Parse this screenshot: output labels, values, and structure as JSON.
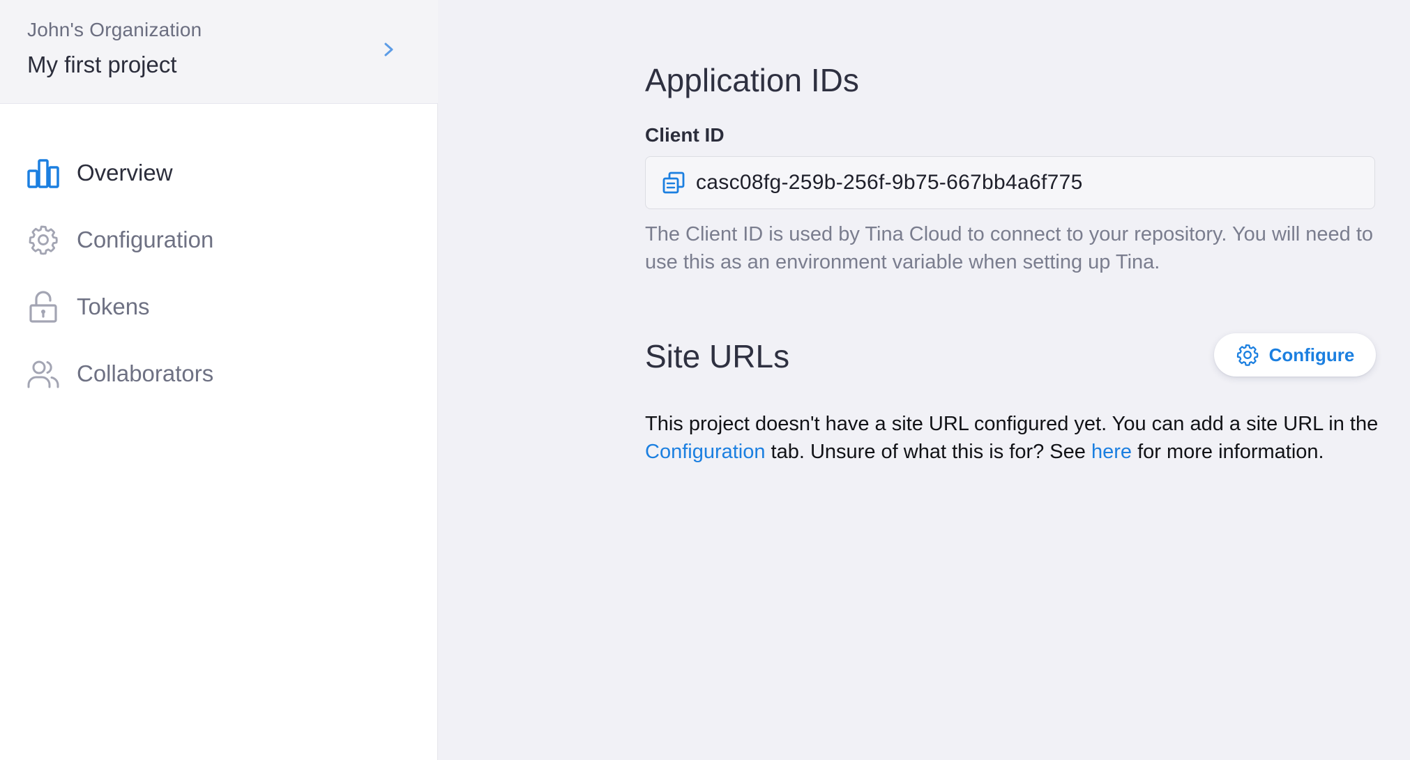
{
  "sidebar": {
    "organization": "John's Organization",
    "project": "My first project",
    "items": [
      {
        "label": "Overview",
        "icon": "bar-chart-icon",
        "active": true
      },
      {
        "label": "Configuration",
        "icon": "gear-icon",
        "active": false
      },
      {
        "label": "Tokens",
        "icon": "unlocked-padlock-icon",
        "active": false
      },
      {
        "label": "Collaborators",
        "icon": "users-icon",
        "active": false
      }
    ]
  },
  "main": {
    "application_ids": {
      "title": "Application IDs",
      "client_id_label": "Client ID",
      "client_id_value": "casc08fg-259b-256f-9b75-667bb4a6f775",
      "help_text": "The Client ID is used by Tina Cloud to connect to your repository. You will need to use this as an environment variable when setting up Tina."
    },
    "site_urls": {
      "title": "Site URLs",
      "configure_label": "Configure",
      "info_part1": "This project doesn't have a site URL configured yet. You can add a site URL in the ",
      "configuration_link": "Configuration",
      "info_part2": " tab. Unsure of what this is for? See ",
      "here_link": "here",
      "info_part3": " for more information."
    }
  },
  "colors": {
    "accent": "#1b7fe0",
    "sidebar_bg": "#ffffff",
    "main_bg": "#f1f1f6",
    "muted_text": "#6e7183"
  }
}
